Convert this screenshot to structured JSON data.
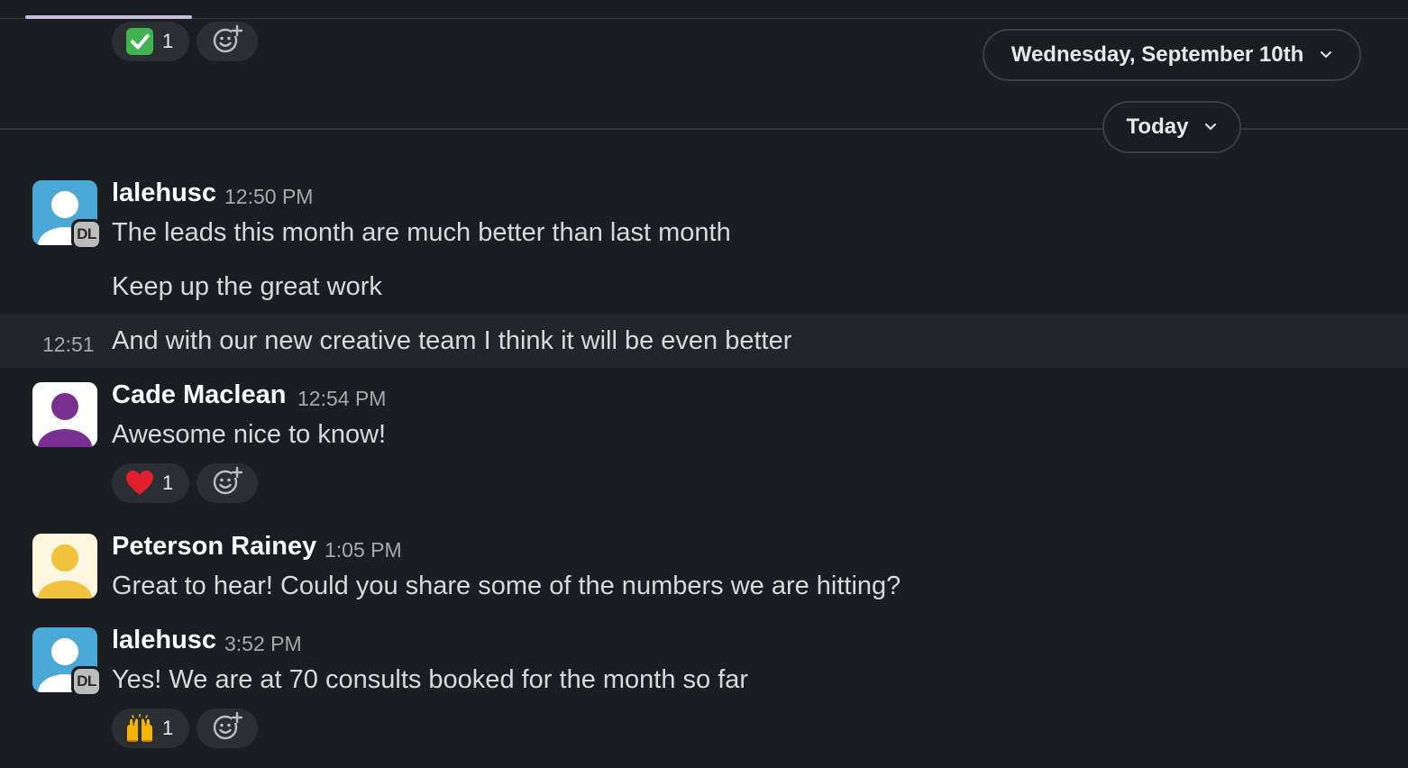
{
  "top_reactions": [
    {
      "emoji": "✅",
      "count": "1"
    }
  ],
  "dividers": {
    "upper": "Wednesday, September 10th",
    "lower": "Today"
  },
  "messages": [
    {
      "sender": "lalehusc",
      "time": "12:50 PM",
      "badge": "DL",
      "lines": [
        "The leads this month are much better than last month",
        "Keep up the great work"
      ]
    },
    {
      "time_short": "12:51",
      "text": "And with our new creative team I think it will be even better"
    },
    {
      "sender": "Cade Maclean",
      "time": "12:54 PM",
      "text": "Awesome nice to know!",
      "reaction": {
        "emoji": "❤️",
        "count": "1"
      }
    },
    {
      "sender": "Peterson Rainey",
      "time": "1:05 PM",
      "text": "Great to hear! Could you share some of the numbers we are hitting?"
    },
    {
      "sender": "lalehusc",
      "time": "3:52 PM",
      "badge": "DL",
      "text": "Yes! We are at 70 consults booked for the month so far",
      "reaction": {
        "emoji": "🙌",
        "count": "1"
      }
    }
  ],
  "colors": {
    "background": "#1a1d21",
    "avatar_blue": "#4aa9d6",
    "avatar_purple": "#7a2f8f",
    "avatar_yellow": "#f0c23e"
  },
  "icons": {
    "add_reaction": "add-reaction-icon",
    "chevron": "chevron-down-icon"
  }
}
